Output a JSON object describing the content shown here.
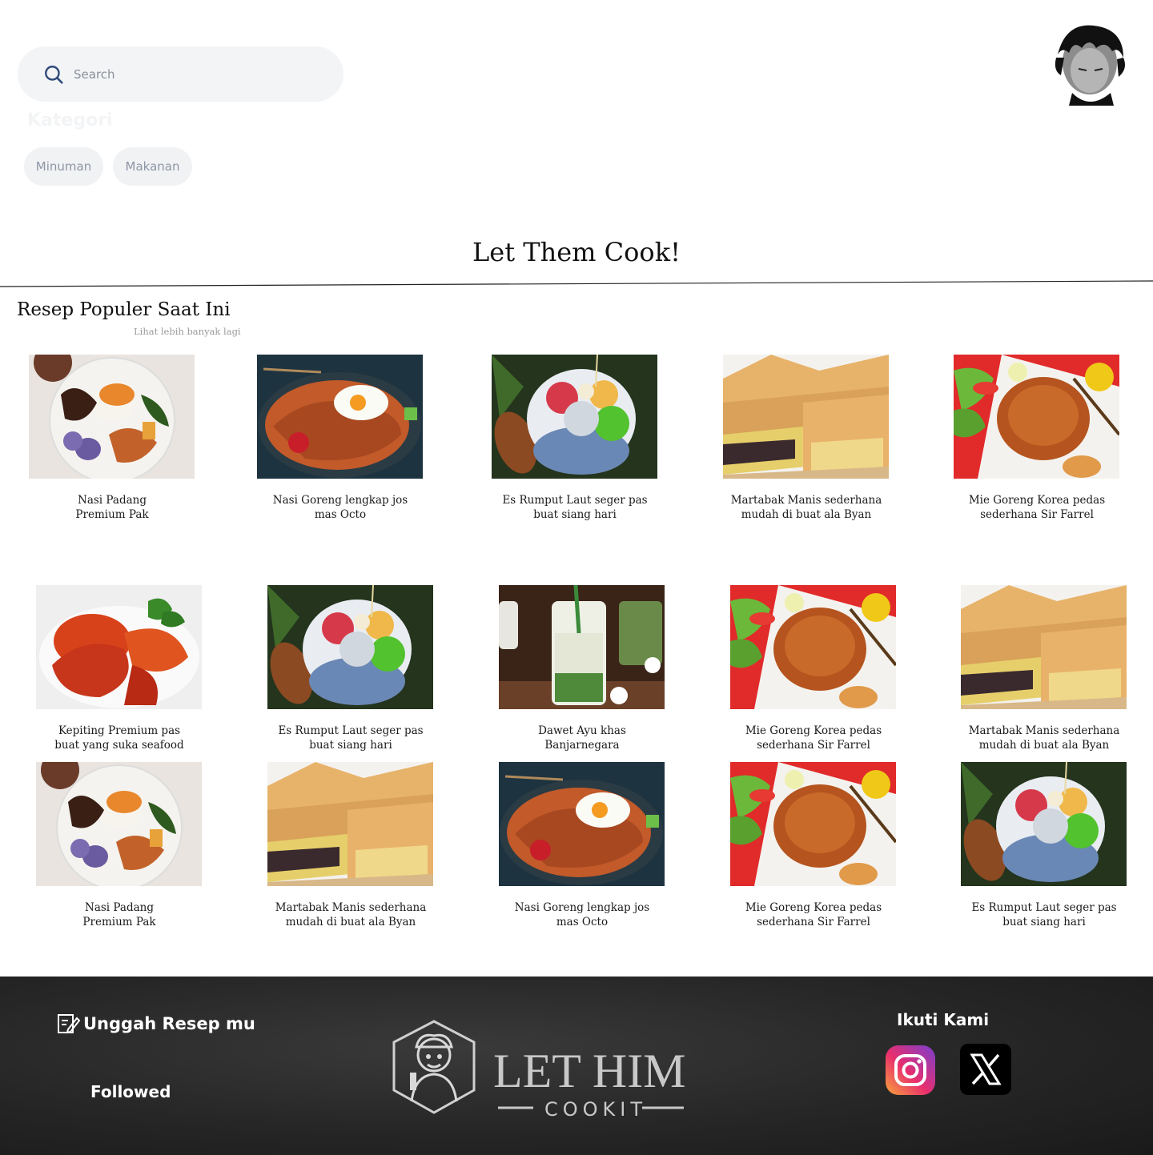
{
  "search": {
    "placeholder": "Search"
  },
  "kategori": {
    "title": "Kategori",
    "chips": [
      "Minuman",
      "Makanan"
    ]
  },
  "hero": {
    "title": "Let Them Cook!"
  },
  "popular": {
    "title": "Resep Populer Saat Ini",
    "see_more": "Lihat lebih banyak lagi",
    "recipes": [
      {
        "title": "Nasi Padang\nPremium Pak",
        "image": "nasi-padang"
      },
      {
        "title": "Nasi Goreng lengkap jos\nmas Octo",
        "image": "nasi-goreng"
      },
      {
        "title": "Es Rumput Laut seger pas\nbuat siang hari",
        "image": "es-rumput-laut"
      },
      {
        "title": "Martabak Manis  sederhana\nmudah di buat ala Byan",
        "image": "martabak"
      },
      {
        "title": "Mie Goreng Korea pedas\nsederhana Sir Farrel",
        "image": "mie-goreng"
      },
      {
        "title": "Kepiting Premium pas\nbuat yang suka seafood",
        "image": "kepiting"
      },
      {
        "title": "Es Rumput Laut seger pas\nbuat siang hari",
        "image": "es-rumput-laut"
      },
      {
        "title": "Dawet Ayu khas\nBanjarnegara",
        "image": "dawet"
      },
      {
        "title": "Mie Goreng Korea pedas\nsederhana Sir Farrel",
        "image": "mie-goreng"
      },
      {
        "title": "Martabak Manis  sederhana\nmudah di buat ala Byan",
        "image": "martabak"
      },
      {
        "title": "Nasi Padang\nPremium Pak",
        "image": "nasi-padang"
      },
      {
        "title": "Martabak Manis  sederhana\nmudah di buat ala Byan",
        "image": "martabak"
      },
      {
        "title": "Nasi Goreng lengkap jos\nmas Octo",
        "image": "nasi-goreng"
      },
      {
        "title": "Mie Goreng Korea pedas\nsederhana Sir Farrel",
        "image": "mie-goreng"
      },
      {
        "title": "Es Rumput Laut seger pas\nbuat siang hari",
        "image": "es-rumput-laut"
      }
    ]
  },
  "footer": {
    "upload_label": "Unggah Resep mu",
    "followed_label": "Followed",
    "follow_title": "Ikuti Kami",
    "logo_line1": "LET HIM",
    "logo_line2": "COOKIT",
    "social_icons": [
      "instagram-icon",
      "x-icon"
    ]
  }
}
